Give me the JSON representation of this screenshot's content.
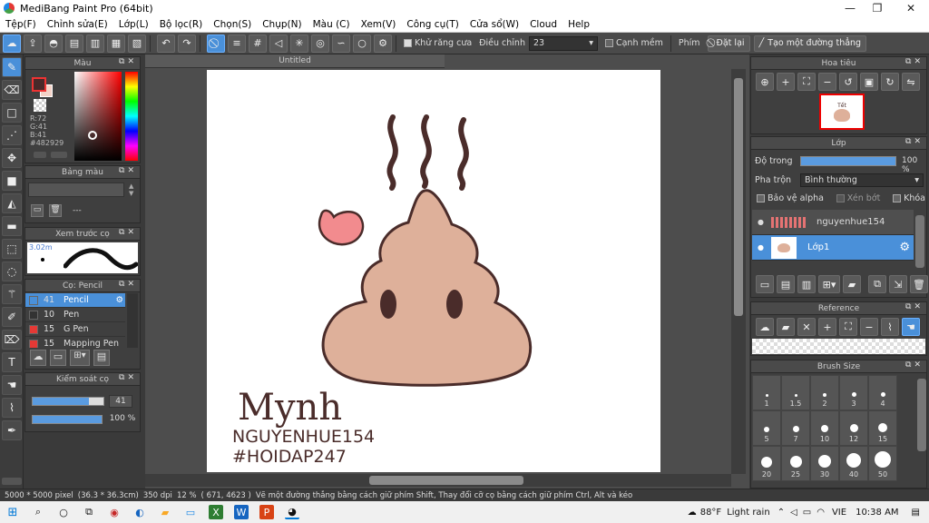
{
  "window": {
    "title": "MediBang Paint Pro (64bit)"
  },
  "menu": [
    "Tệp(F)",
    "Chỉnh sửa(E)",
    "Lớp(L)",
    "Bộ lọc(R)",
    "Chọn(S)",
    "Chụp(N)",
    "Màu (C)",
    "Xem(V)",
    "Công cụ(T)",
    "Cửa sổ(W)",
    "Cloud",
    "Help"
  ],
  "toolbar": {
    "antialias_label": "Khử răng cưa",
    "adjust_label": "Điều chỉnh",
    "adjust_value": "23",
    "soft_edge_label": "Cạnh mềm",
    "key_label": "Phím",
    "reset_label": "Đặt lại",
    "line_label": "Tạo một đường thẳng"
  },
  "color_panel": {
    "title": "Màu",
    "r": "R:72",
    "g": "G:41",
    "b": "B:41",
    "hex": "#482929"
  },
  "palette_panel": {
    "title": "Bảng màu",
    "value": "---"
  },
  "brush_preview_panel": {
    "title": "Xem trước cọ",
    "size": "3.02m"
  },
  "brush_panel": {
    "title": "Cọ: Pencil",
    "items": [
      {
        "num": "41",
        "name": "Pencil",
        "color": "#4a90d9"
      },
      {
        "num": "10",
        "name": "Pen",
        "color": "#333333"
      },
      {
        "num": "15",
        "name": "G Pen",
        "color": "#e53935"
      },
      {
        "num": "15",
        "name": "Mapping Pen",
        "color": "#e53935"
      }
    ]
  },
  "brush_control": {
    "title": "Kiểm soát cọ",
    "size_value": "41",
    "opacity_value": "100 %",
    "size_fraction": 0.8,
    "opacity_fraction": 1.0
  },
  "document": {
    "tab": "Untitled"
  },
  "artwork": {
    "signature": "Mynh",
    "line1": "NGUYENHUE154",
    "line2": "#HOIDAP247"
  },
  "navigator": {
    "title": "Hoa tiêu",
    "thumb_text": "Tết"
  },
  "layer_panel": {
    "title": "Lớp",
    "opacity_label": "Độ trong",
    "opacity_value": "100 %",
    "opacity_fraction": 1.0,
    "blend_label": "Pha trộn",
    "blend_value": "Bình thường",
    "protect_alpha": "Bảo vệ alpha",
    "clip": "Xén bớt",
    "lock": "Khóa",
    "layers": [
      {
        "name": "nguyenhue154",
        "selected": false
      },
      {
        "name": "Lớp1",
        "selected": true
      }
    ]
  },
  "reference_panel": {
    "title": "Reference"
  },
  "brush_size_panel": {
    "title": "Brush Size",
    "sizes": [
      "1",
      "1.5",
      "2",
      "3",
      "4",
      "5",
      "7",
      "10",
      "12",
      "15",
      "20",
      "25",
      "30",
      "40",
      "50"
    ]
  },
  "status": {
    "size": "5000 * 5000 pixel",
    "cm": "(36.3 * 36.3cm)",
    "dpi": "350 dpi",
    "zoom": "12 %",
    "coords": "( 671, 4623 )",
    "hint": "Vẽ một đường thẳng bằng cách giữ phím Shift, Thay đổi cỡ cọ bằng cách giữ phím Ctrl, Alt và kéo"
  },
  "taskbar": {
    "weather_temp": "88°F",
    "weather_text": "Light rain",
    "lang": "VIE",
    "time": "10:38 AM"
  }
}
